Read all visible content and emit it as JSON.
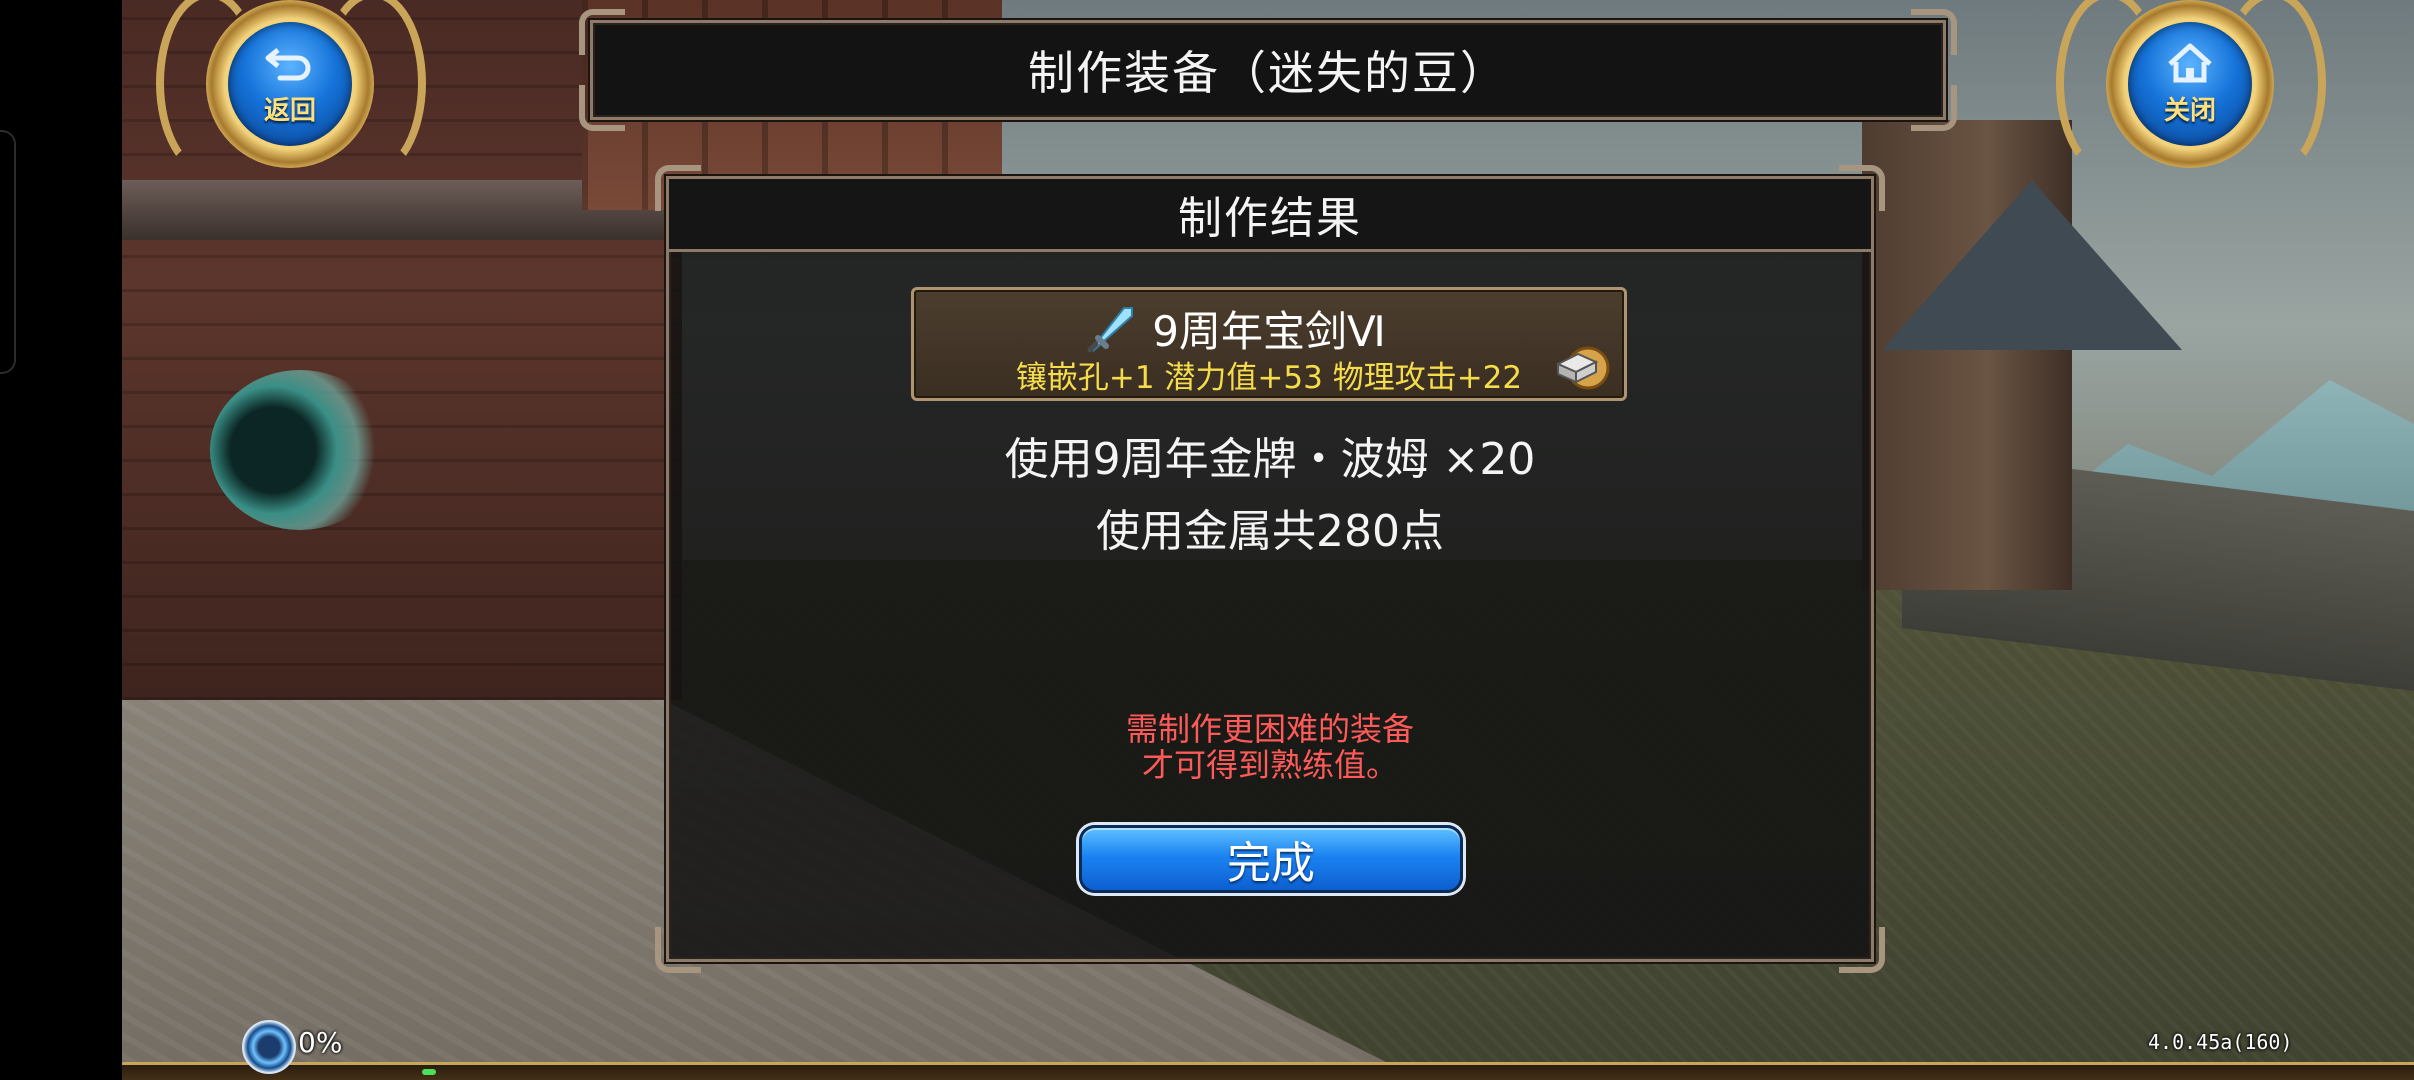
{
  "window": {
    "title": "制作装备（迷失的豆）"
  },
  "buttons": {
    "back_label": "返回",
    "close_label": "关闭",
    "back_icon": "return-arrow-icon",
    "close_icon": "home-icon",
    "done_label": "完成"
  },
  "dialog": {
    "header": "制作结果",
    "item": {
      "name": "9周年宝剑Ⅵ",
      "stats": "镶嵌孔+1  潜力值+53  物理攻击+22",
      "icon": "sword-icon",
      "badge_icon": "metal-ingot-icon"
    },
    "materials_used": "使用9周年金牌・波姆  ×20",
    "metal_used": "使用金属共280点",
    "warning_line1": "需制作更困难的装备",
    "warning_line2": "才可得到熟练值。",
    "warning_color": "#ff5a5a"
  },
  "hud": {
    "exp_percent": "0%",
    "exp_fraction": 0.0,
    "version": "4.0.45a(160)"
  },
  "colors": {
    "accent_gold": "#c9a55a",
    "button_blue": "#1c83f2",
    "stat_yellow": "#f5dc4a"
  }
}
